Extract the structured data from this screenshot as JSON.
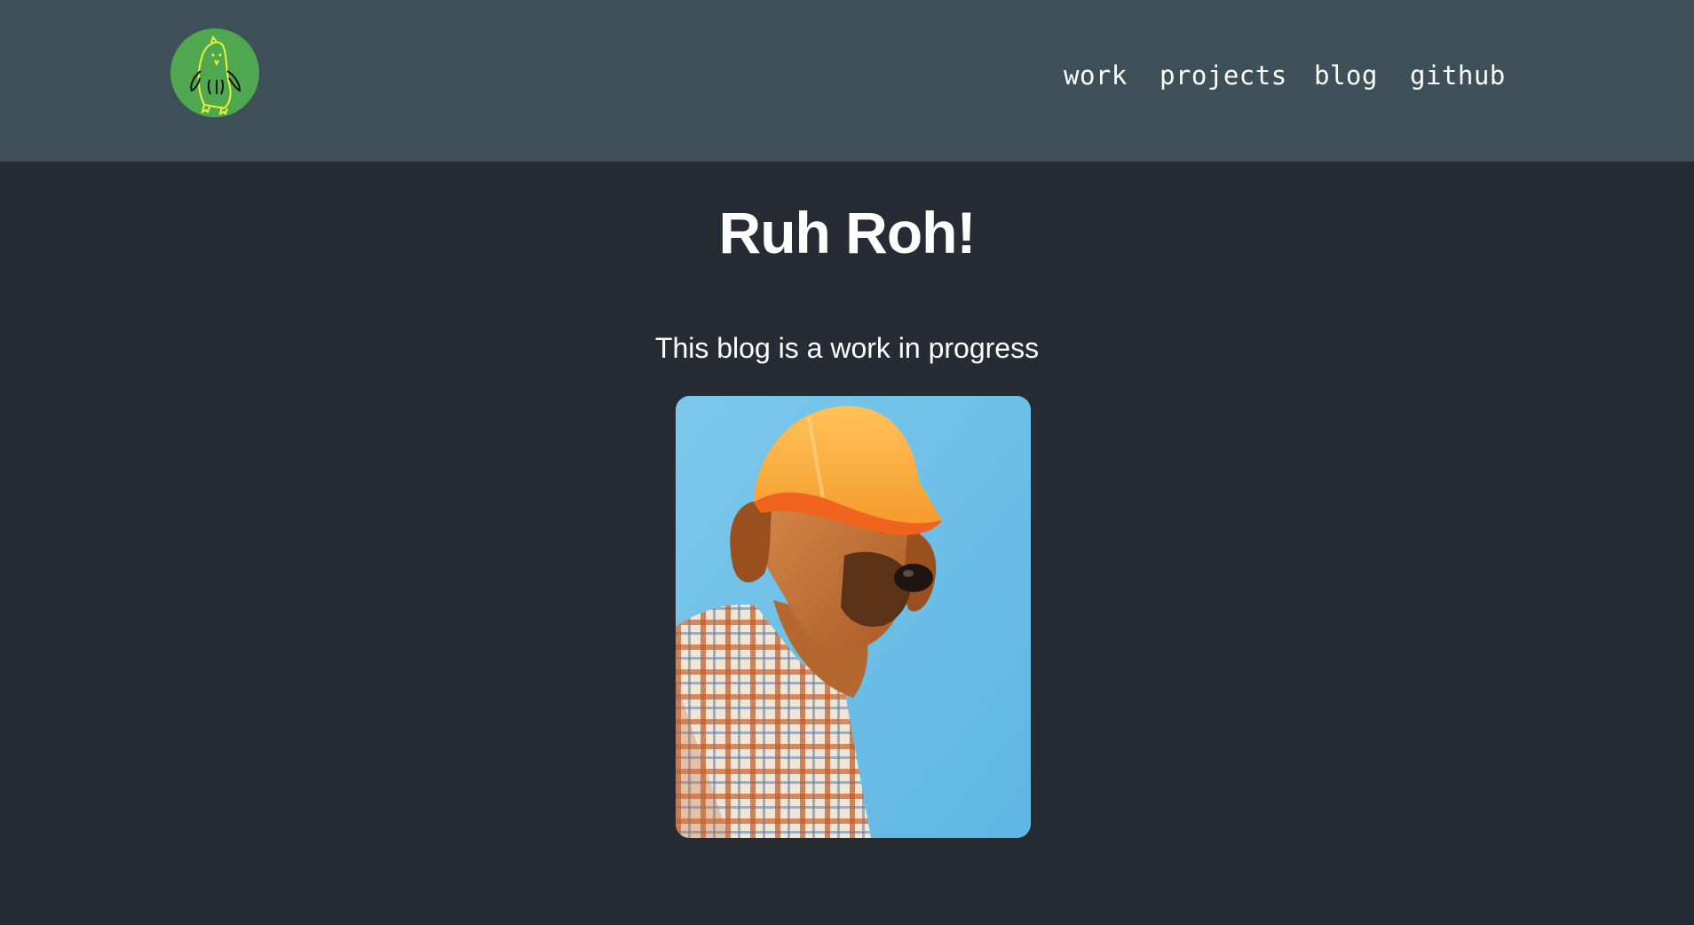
{
  "header": {
    "logo": {
      "icon": "bird-doodle-icon",
      "background_color": "#4fa84f",
      "stroke_color": "#e8f23a"
    },
    "nav": {
      "items": [
        {
          "label": "work"
        },
        {
          "label": "projects"
        },
        {
          "label": "blog"
        },
        {
          "label": "github"
        }
      ]
    },
    "background_color": "#3d4f57"
  },
  "main": {
    "title": "Ruh Roh!",
    "subtitle": "This blog is a work in progress",
    "image": {
      "subject": "dog-in-hard-hat-image"
    },
    "background_color": "#272b34"
  }
}
